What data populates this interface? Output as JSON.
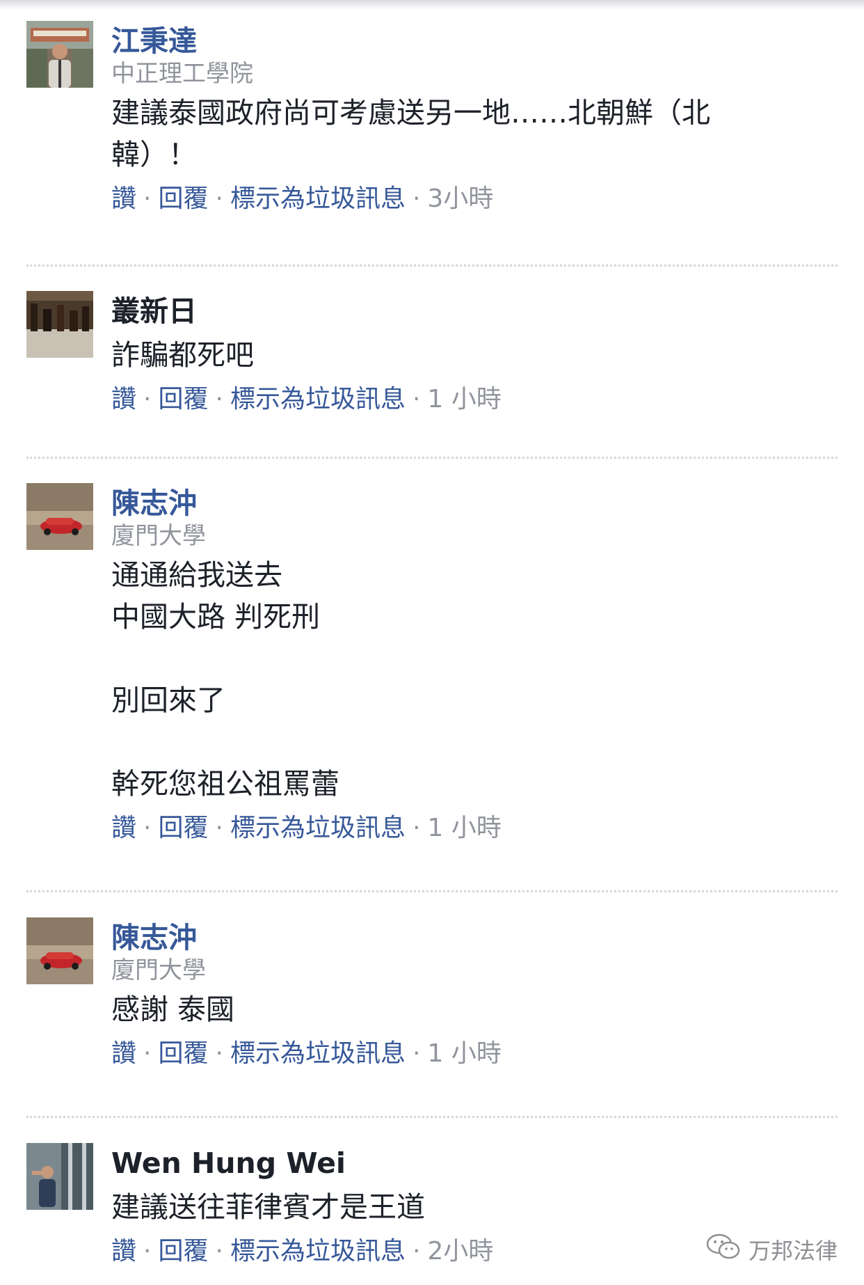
{
  "actions": {
    "like": "讚",
    "reply": "回覆",
    "spam": "標示為垃圾訊息",
    "dot": "·"
  },
  "comments": [
    {
      "author": "江秉達",
      "affiliation": "中正理工學院",
      "text": "建議泰國政府尚可考慮送另一地……北朝鮮（北\n韓）！",
      "time": "3小時"
    },
    {
      "author": "叢新日",
      "affiliation": "",
      "text": "詐騙都死吧",
      "time": "1 小時"
    },
    {
      "author": "陳志沖",
      "affiliation": "廈門大學",
      "text": "通通給我送去\n中國大路 判死刑\n\n別回來了\n\n幹死您祖公祖罵蕾",
      "time": "1 小時"
    },
    {
      "author": "陳志沖",
      "affiliation": "廈門大學",
      "text": "感謝 泰國",
      "time": "1 小時"
    },
    {
      "author": "Wen Hung Wei",
      "affiliation": "",
      "text": "建議送往菲律賓才是王道",
      "time": "2小時"
    }
  ],
  "watermark": {
    "icon": "wechat-icon",
    "text": "万邦法律"
  }
}
